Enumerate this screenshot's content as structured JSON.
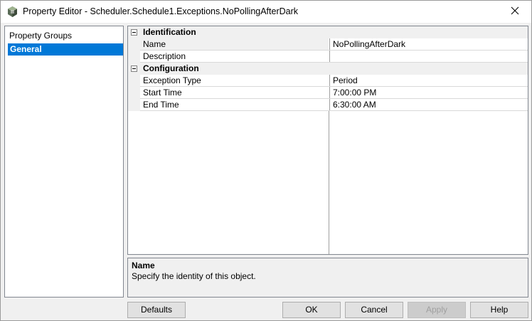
{
  "window": {
    "title": "Property Editor - Scheduler.Schedule1.Exceptions.NoPollingAfterDark"
  },
  "groups": {
    "header": "Property Groups",
    "items": [
      {
        "label": "General",
        "selected": true
      }
    ]
  },
  "grid": {
    "categories": [
      {
        "label": "Identification",
        "properties": [
          {
            "name": "Name",
            "value": "NoPollingAfterDark"
          },
          {
            "name": "Description",
            "value": ""
          }
        ]
      },
      {
        "label": "Configuration",
        "properties": [
          {
            "name": "Exception Type",
            "value": "Period"
          },
          {
            "name": "Start Time",
            "value": "7:00:00 PM"
          },
          {
            "name": "End Time",
            "value": "6:30:00 AM"
          }
        ]
      }
    ]
  },
  "help": {
    "title": "Name",
    "description": "Specify the identity of this object."
  },
  "buttons": {
    "defaults": "Defaults",
    "ok": "OK",
    "cancel": "Cancel",
    "apply": "Apply",
    "help": "Help"
  },
  "colors": {
    "selection": "#0078d7",
    "disabled_text": "#a0a0a0"
  }
}
